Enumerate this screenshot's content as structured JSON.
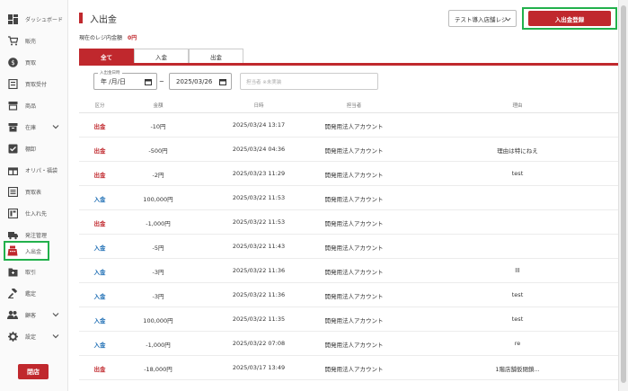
{
  "sidebar": {
    "items": [
      {
        "label": "ダッシュボード",
        "icon": "dashboard-icon"
      },
      {
        "label": "販売",
        "icon": "cart-icon"
      },
      {
        "label": "買取",
        "icon": "coin-icon"
      },
      {
        "label": "買取受付",
        "icon": "receipt-icon"
      },
      {
        "label": "商品",
        "icon": "store-icon"
      },
      {
        "label": "在庫",
        "icon": "inventory-icon"
      },
      {
        "label": "棚卸",
        "icon": "checkbox-icon"
      },
      {
        "label": "オリパ・福袋",
        "icon": "gift-icon"
      },
      {
        "label": "買取表",
        "icon": "list-icon"
      },
      {
        "label": "仕入れ先",
        "icon": "supplier-icon"
      },
      {
        "label": "発注管理",
        "icon": "truck-icon"
      },
      {
        "label": "入出金",
        "icon": "register-icon"
      },
      {
        "label": "取引",
        "icon": "folder-icon"
      },
      {
        "label": "鑑定",
        "icon": "gavel-icon"
      },
      {
        "label": "顧客",
        "icon": "people-icon"
      },
      {
        "label": "設定",
        "icon": "gear-icon"
      }
    ],
    "close_label": "閉店"
  },
  "header": {
    "title": "入出金",
    "register_select": "テスト導入店舗レジ",
    "add_label": "入出金登録",
    "balance_label": "現在のレジ内金額",
    "balance_value": "0円"
  },
  "tabs": [
    "全て",
    "入金",
    "出金"
  ],
  "filters": {
    "date_label": "入出金日時",
    "date_from": "年 /月/日",
    "date_to": "2025/03/26",
    "staff_placeholder": "担当者 ※未実装"
  },
  "table": {
    "headers": [
      "区分",
      "金額",
      "日時",
      "担当者",
      "理由"
    ],
    "rows": [
      {
        "kind": "出金",
        "amount": "-10円",
        "datetime": "2025/03/24 13:17",
        "staff": "開発用法人アカウント",
        "reason": ""
      },
      {
        "kind": "出金",
        "amount": "-500円",
        "datetime": "2025/03/24 04:36",
        "staff": "開発用法人アカウント",
        "reason": "理由は特にねえ"
      },
      {
        "kind": "出金",
        "amount": "-2円",
        "datetime": "2025/03/23 11:29",
        "staff": "開発用法人アカウント",
        "reason": "test"
      },
      {
        "kind": "入金",
        "amount": "100,000円",
        "datetime": "2025/03/22 11:53",
        "staff": "開発用法人アカウント",
        "reason": ""
      },
      {
        "kind": "出金",
        "amount": "-1,000円",
        "datetime": "2025/03/22 11:53",
        "staff": "開発用法人アカウント",
        "reason": ""
      },
      {
        "kind": "入金",
        "amount": "-5円",
        "datetime": "2025/03/22 11:43",
        "staff": "開発用法人アカウント",
        "reason": ""
      },
      {
        "kind": "入金",
        "amount": "-3円",
        "datetime": "2025/03/22 11:36",
        "staff": "開発用法人アカウント",
        "reason": "lll"
      },
      {
        "kind": "入金",
        "amount": "-3円",
        "datetime": "2025/03/22 11:36",
        "staff": "開発用法人アカウント",
        "reason": "test"
      },
      {
        "kind": "入金",
        "amount": "100,000円",
        "datetime": "2025/03/22 11:35",
        "staff": "開発用法人アカウント",
        "reason": "test"
      },
      {
        "kind": "入金",
        "amount": "-1,000円",
        "datetime": "2025/03/22 07:08",
        "staff": "開発用法人アカウント",
        "reason": "re"
      },
      {
        "kind": "出金",
        "amount": "-18,000円",
        "datetime": "2025/03/17 13:49",
        "staff": "開発用法人アカウント",
        "reason": "1階店舗仮閉鎖..."
      }
    ]
  },
  "colors": {
    "accent": "#c0282d",
    "in": "#1f6fb5",
    "highlight": "#22b14c"
  }
}
